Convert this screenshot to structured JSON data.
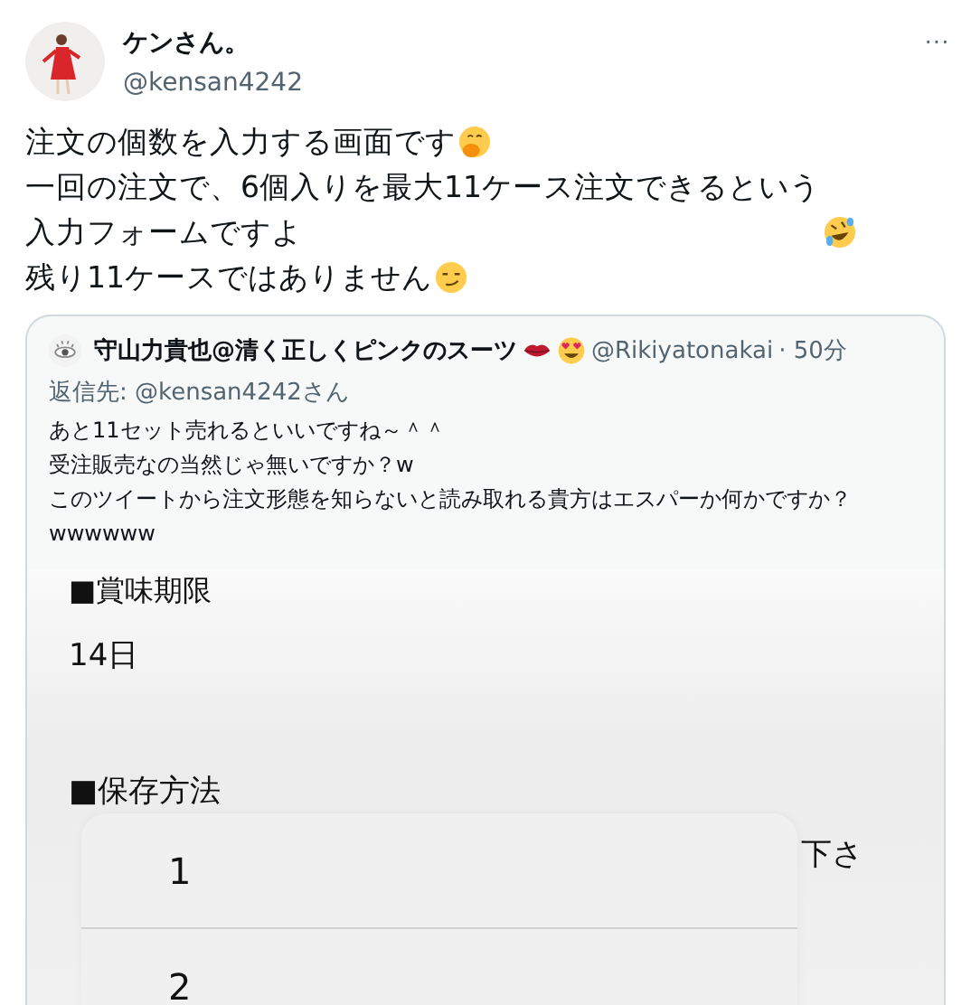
{
  "tweet": {
    "display_name": "ケンさん。",
    "handle": "@kensan4242",
    "more": "···",
    "lines": [
      "注文の個数を入力する画面です",
      "一回の注文で、6個入りを最大11ケース注文できるという入力フォームですよ",
      "残り11ケースではありません"
    ]
  },
  "quote": {
    "display_name": "守山力貴也@清く正しくピンクのスーツ",
    "handle": "@Rikiyatonakai",
    "time": "· 50分",
    "reply_to": "返信先: @kensan4242さん",
    "lines": [
      "あと11セット売れるといいですね～＾＾",
      "受注販売なの当然じゃ無いですか？w",
      "このツイートから注文形態を知らないと読み取れる貴方はエスパーか何かですか？wwwwww"
    ],
    "attached_screenshot": {
      "heading_1": "■賞味期限",
      "value_1": "14日",
      "heading_2": "■保存方法",
      "text_fragment": "下さ",
      "picker_options": [
        "1",
        "2"
      ]
    }
  }
}
